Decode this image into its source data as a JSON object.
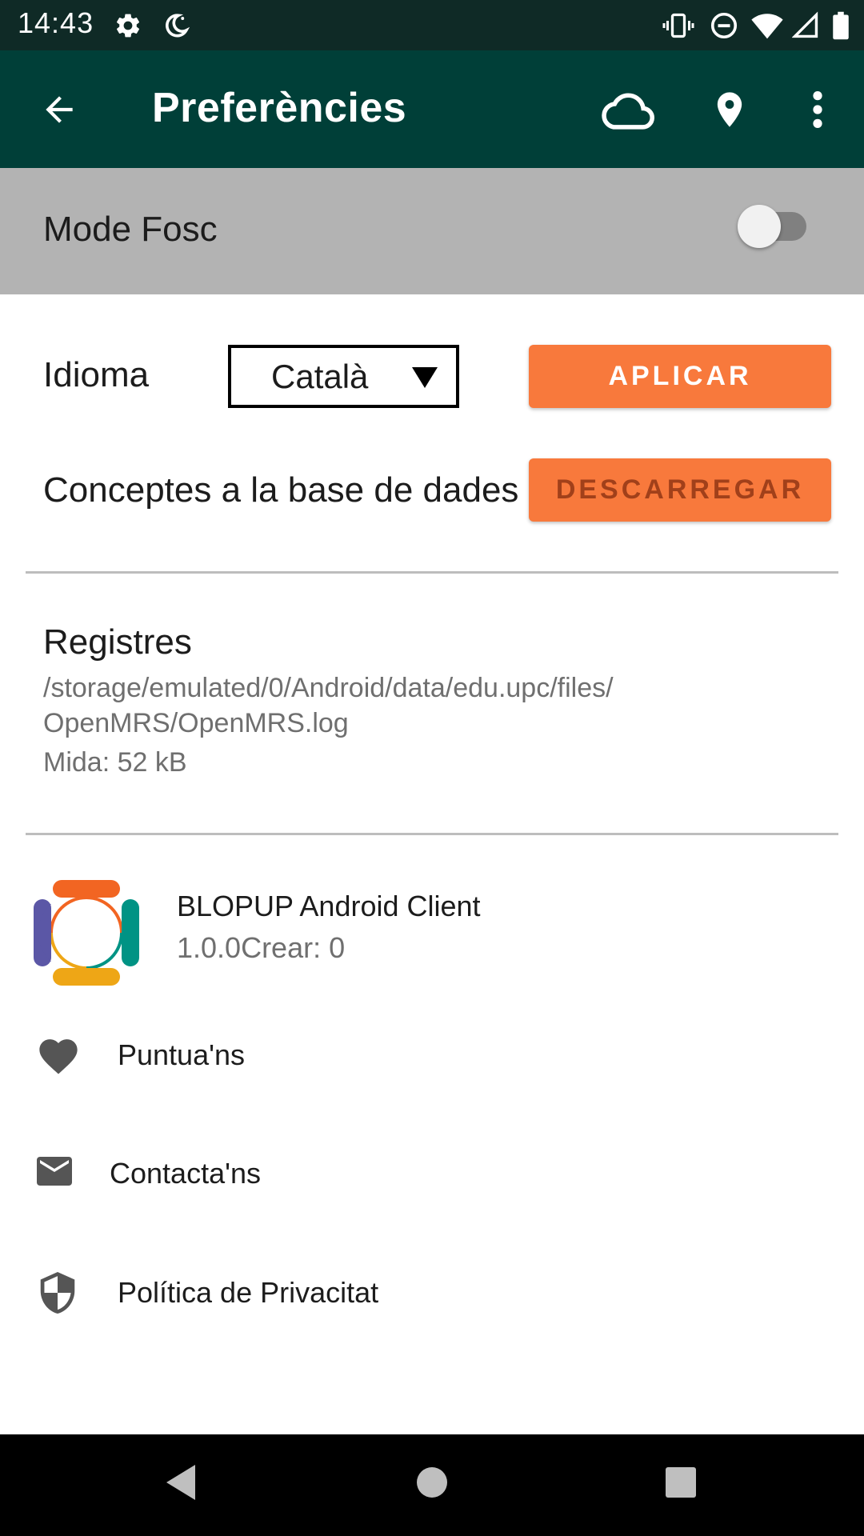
{
  "status_bar": {
    "time": "14:43",
    "left_icons": [
      "settings-icon",
      "do-not-disturb-moon-icon"
    ],
    "right_icons": [
      "vibrate-icon",
      "do-not-disturb-icon",
      "wifi-icon",
      "signal-icon",
      "battery-icon"
    ]
  },
  "app_bar": {
    "title": "Preferències",
    "actions": [
      "back-arrow-icon",
      "cloud-icon",
      "location-pin-icon",
      "more-vert-icon"
    ],
    "color": "#003f38"
  },
  "dark_mode": {
    "label": "Mode Fosc",
    "enabled": false
  },
  "language": {
    "label": "Idioma",
    "selected": "Català",
    "apply_label": "APLICAR"
  },
  "concepts": {
    "label": "Conceptes a la base de dades",
    "download_label": "DESCARREGAR"
  },
  "logs": {
    "title": "Registres",
    "path_line1": "/storage/emulated/0/Android/data/edu.upc/files/",
    "path_line2": "OpenMRS/OpenMRS.log",
    "size": "Mida: 52 kB"
  },
  "about": {
    "app_name": "BLOPUP Android Client",
    "version": "1.0.0Crear: 0"
  },
  "menu": {
    "rate_label": "Puntua'ns",
    "contact_label": "Contacta'ns",
    "privacy_label": "Política de Privacitat"
  },
  "colors": {
    "accent": "#f8793c",
    "status_bar": "#0f2a26",
    "dark_mode_row": "#b3b3b3"
  }
}
